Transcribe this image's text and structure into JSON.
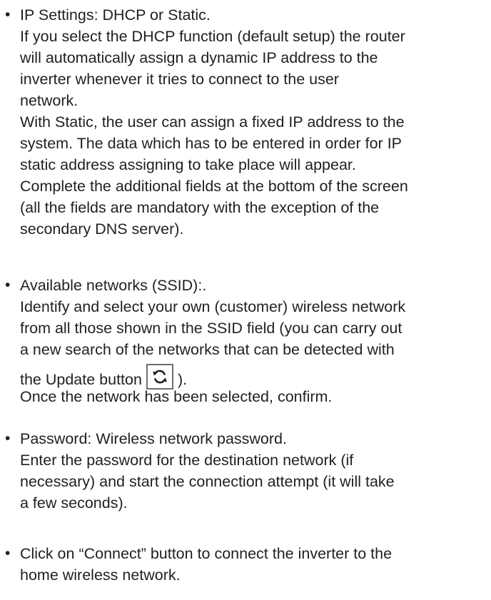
{
  "bullet_glyph": "•",
  "sections": {
    "ip_settings": {
      "lines": [
        "IP Settings: DHCP or Static.",
        "If you select the DHCP function (default setup) the router",
        "will automatically assign a dynamic IP address to the",
        "inverter whenever it tries to connect to the user",
        "network.",
        "With Static, the user can assign a fixed IP address to the",
        "system. The data which has to be entered in order for IP",
        "static address assigning to take place will appear.",
        "Complete the additional fields at the bottom of the screen",
        "(all the fields are mandatory with the exception of the",
        "secondary DNS server)."
      ]
    },
    "available_networks": {
      "lines": [
        "Available networks (SSID):.",
        "Identify and select your own (customer) wireless network",
        "from all those shown in the SSID field (you can carry out",
        "a new search of the networks that can be detected with"
      ],
      "update_prefix": "the Update button",
      "update_suffix": ").",
      "update_icon": "refresh-icon",
      "confirm_line": "Once the network has been selected, confirm."
    },
    "password": {
      "lines": [
        "Password: Wireless network password.",
        "Enter the password for the destination network (if",
        "necessary) and start the connection attempt (it will take",
        "a few seconds)."
      ]
    },
    "connect": {
      "lines": [
        "Click on “Connect” button to connect the inverter to the",
        "home wireless network."
      ]
    }
  }
}
